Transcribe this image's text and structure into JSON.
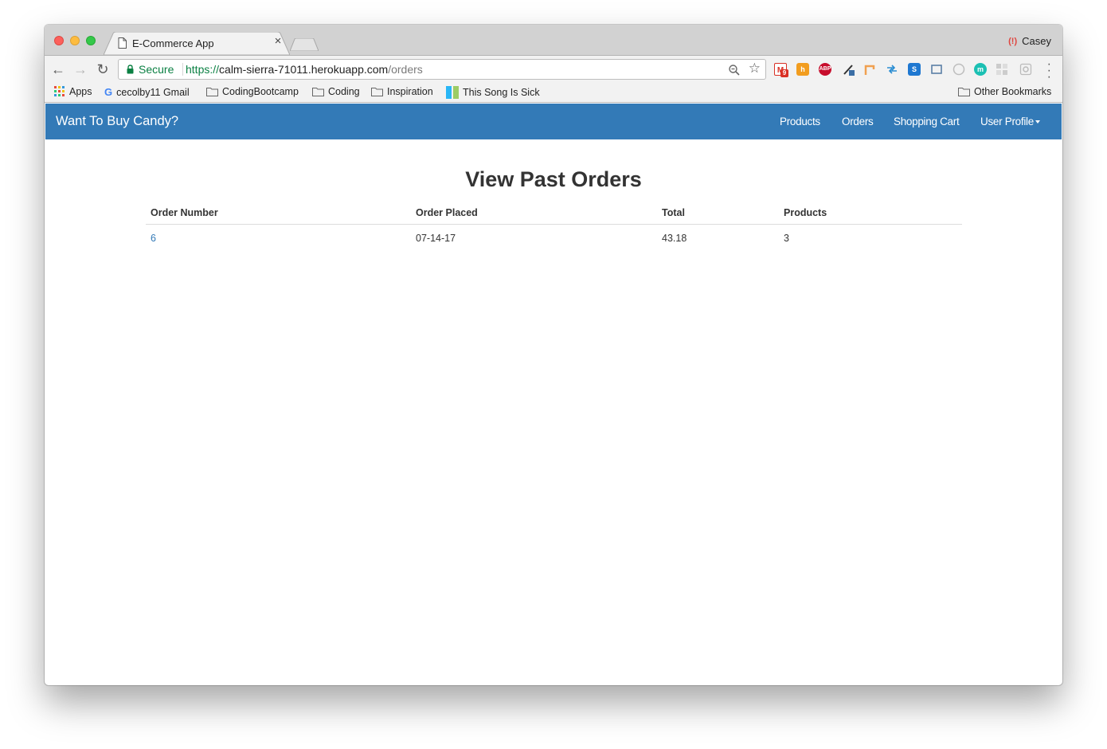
{
  "browser": {
    "tab_title": "E-Commerce App",
    "tab_close": "×",
    "profile_name": "Casey",
    "secure_label": "Secure",
    "url_scheme": "https://",
    "url_host": "calm-sierra-71011.herokuapp.com",
    "url_path": "/orders",
    "extensions": [
      {
        "name": "gmail-extension-icon",
        "badge": "9",
        "color": "#d93025"
      },
      {
        "name": "honey-extension-icon",
        "color": "#f29d1f"
      },
      {
        "name": "adblock-plus-icon",
        "label": "ABP",
        "color": "#c70d2c"
      },
      {
        "name": "color-picker-icon",
        "color": "#3b6ea5"
      },
      {
        "name": "postman-interceptor-icon",
        "color": "#f0a050"
      },
      {
        "name": "redux-devtools-icon",
        "color": "#2a8dd2"
      },
      {
        "name": "s-extension-icon",
        "label": "S",
        "color": "#1f78d1"
      },
      {
        "name": "screenshot-extension-icon",
        "color": "#5b7fa6"
      },
      {
        "name": "clock-extension-icon",
        "color": "#bdbdbd"
      },
      {
        "name": "momentum-extension-icon",
        "label": "m",
        "color": "#1bc0b3"
      },
      {
        "name": "grid-extension-icon",
        "color": "#cccccc"
      },
      {
        "name": "settings-extension-icon",
        "color": "#bbbbbb"
      }
    ]
  },
  "bookmarks": {
    "items": [
      {
        "label": "Apps",
        "icon": "apps-grid-icon"
      },
      {
        "label": "cecolby11 Gmail",
        "icon": "google-icon"
      },
      {
        "label": "CodingBootcamp",
        "icon": "folder-icon"
      },
      {
        "label": "Coding",
        "icon": "folder-icon"
      },
      {
        "label": "Inspiration",
        "icon": "folder-icon"
      },
      {
        "label": "This Song Is Sick",
        "icon": "site-icon"
      }
    ],
    "other": "Other Bookmarks"
  },
  "navbar": {
    "brand": "Want To Buy Candy?",
    "links": [
      "Products",
      "Orders",
      "Shopping Cart",
      "User Profile"
    ]
  },
  "main": {
    "title": "View Past Orders",
    "table": {
      "headers": [
        "Order Number",
        "Order Placed",
        "Total",
        "Products"
      ],
      "rows": [
        [
          "6",
          "07-14-17",
          "43.18",
          "3"
        ]
      ]
    }
  }
}
